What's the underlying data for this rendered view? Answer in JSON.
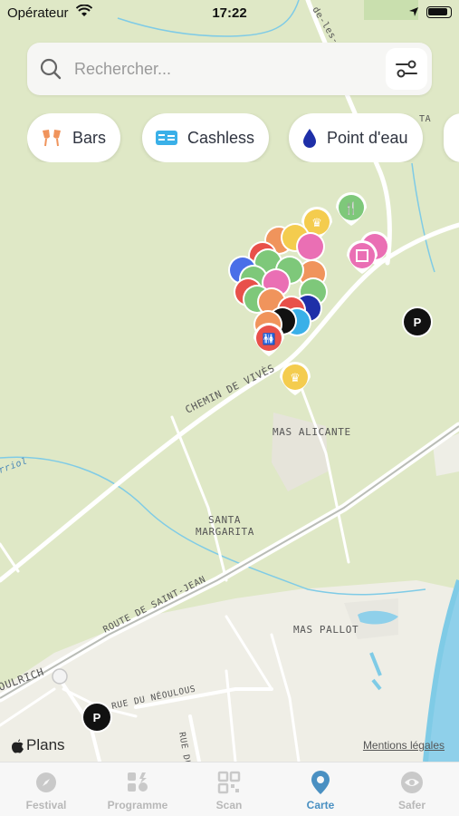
{
  "status_bar": {
    "carrier": "Opérateur",
    "time": "17:22"
  },
  "search": {
    "placeholder": "Rechercher..."
  },
  "chips": [
    {
      "label": "Bars",
      "icon": "cheers-icon",
      "color": "#f0945c"
    },
    {
      "label": "Cashless",
      "icon": "card-icon",
      "color": "#3ab0e8"
    },
    {
      "label": "Point d'eau",
      "icon": "water-drop-icon",
      "color": "#1e2fa8"
    }
  ],
  "map": {
    "labels": {
      "chemin": "CHEMIN DE VIVÈS",
      "mas_alicante": "MAS ALICANTE",
      "santa_1": "SANTA",
      "santa_2": "MARGARITA",
      "route": "ROUTE DE SAINT-JEAN",
      "mas_pallot": "MAS PALLOT",
      "rue_neoulous": "RUE DU NÉOULOUS",
      "rue_du": "RUE DU",
      "oulrich": "OULRICH",
      "riol": "rriol",
      "top_road": "de-les-A",
      "ta": "TA"
    },
    "parking_label": "P"
  },
  "attribution": {
    "brand": "Plans",
    "legal": "Mentions légales"
  },
  "tabs": [
    {
      "label": "Festival",
      "icon": "compass-icon",
      "active": false
    },
    {
      "label": "Programme",
      "icon": "programme-icon",
      "active": false
    },
    {
      "label": "Scan",
      "icon": "qr-scan-icon",
      "active": false
    },
    {
      "label": "Carte",
      "icon": "map-pin-icon",
      "active": true
    },
    {
      "label": "Safer",
      "icon": "eye-icon",
      "active": false
    }
  ],
  "colors": {
    "map_bg": "#dfe8c6",
    "road": "#ffffff",
    "water": "#7fcbe6",
    "active_tab": "#4a90c2",
    "pin_green": "#7ec87a",
    "pin_pink": "#ea6fb4",
    "pin_yellow": "#f4cc4e",
    "pin_red": "#e8504a",
    "pin_orange": "#f0945c",
    "pin_blue": "#4a6fe8",
    "pin_navy": "#1e2fa8",
    "pin_cyan": "#3ab0e8"
  }
}
